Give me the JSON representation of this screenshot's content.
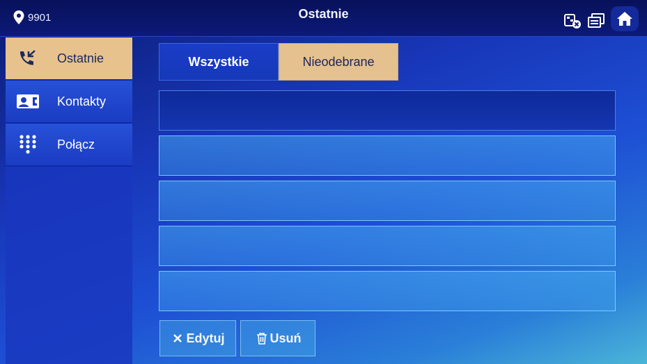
{
  "header": {
    "location_number": "9901",
    "title": "Ostatnie",
    "icons": [
      "location-pin-icon",
      "network-disconnected-icon",
      "monitor-icon",
      "home-icon"
    ]
  },
  "sidebar": {
    "items": [
      {
        "label": "Ostatnie",
        "icon": "recent-calls-icon",
        "active": true
      },
      {
        "label": "Kontakty",
        "icon": "contacts-icon",
        "active": false
      },
      {
        "label": "Połącz",
        "icon": "dialpad-icon",
        "active": false
      }
    ]
  },
  "tabs": [
    {
      "label": "Wszystkie",
      "active": false
    },
    {
      "label": "Nieodebrane",
      "active": true
    }
  ],
  "list": {
    "rows": [
      "",
      "",
      "",
      "",
      ""
    ]
  },
  "actions": {
    "edit_label": "Edytuj",
    "delete_label": "Usuń"
  },
  "colors": {
    "accent": "#e6c190",
    "background": "#1d4fd4",
    "header": "#0c1a78"
  }
}
